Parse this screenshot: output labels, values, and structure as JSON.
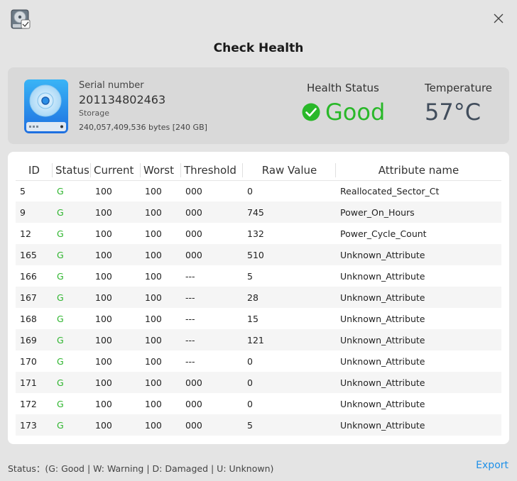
{
  "window": {
    "title": "Check Health"
  },
  "device": {
    "serial_label": "Serial number",
    "serial_value": "201134802463",
    "storage_label": "Storage",
    "storage_value": "240,057,409,536 bytes [240 GB]"
  },
  "health": {
    "label": "Health Status",
    "value": "Good",
    "color": "#29b829"
  },
  "temperature": {
    "label": "Temperature",
    "value": "57°C"
  },
  "table": {
    "headers": [
      "ID",
      "Status",
      "Current",
      "Worst",
      "Threshold",
      "Raw Value",
      "Attribute name"
    ],
    "rows": [
      [
        "5",
        "G",
        "100",
        "100",
        "000",
        "0",
        "Reallocated_Sector_Ct"
      ],
      [
        "9",
        "G",
        "100",
        "100",
        "000",
        "745",
        "Power_On_Hours"
      ],
      [
        "12",
        "G",
        "100",
        "100",
        "000",
        "132",
        "Power_Cycle_Count"
      ],
      [
        "165",
        "G",
        "100",
        "100",
        "000",
        "510",
        "Unknown_Attribute"
      ],
      [
        "166",
        "G",
        "100",
        "100",
        "---",
        "5",
        "Unknown_Attribute"
      ],
      [
        "167",
        "G",
        "100",
        "100",
        "---",
        "28",
        "Unknown_Attribute"
      ],
      [
        "168",
        "G",
        "100",
        "100",
        "---",
        "15",
        "Unknown_Attribute"
      ],
      [
        "169",
        "G",
        "100",
        "100",
        "---",
        "121",
        "Unknown_Attribute"
      ],
      [
        "170",
        "G",
        "100",
        "100",
        "---",
        "0",
        "Unknown_Attribute"
      ],
      [
        "171",
        "G",
        "100",
        "100",
        "000",
        "0",
        "Unknown_Attribute"
      ],
      [
        "172",
        "G",
        "100",
        "100",
        "000",
        "0",
        "Unknown_Attribute"
      ],
      [
        "173",
        "G",
        "100",
        "100",
        "000",
        "5",
        "Unknown_Attribute"
      ]
    ]
  },
  "footer": {
    "legend": "Status：(G: Good | W: Warning | D: Damaged | U: Unknown)",
    "export_label": "Export"
  },
  "icons": {
    "app": "disk-utility-icon",
    "close": "close-icon",
    "disk": "hard-disk-icon",
    "health": "check-circle-icon"
  },
  "colors": {
    "accent": "#1e90e8",
    "good": "#2fb52f",
    "temperature": "#414d5c"
  }
}
